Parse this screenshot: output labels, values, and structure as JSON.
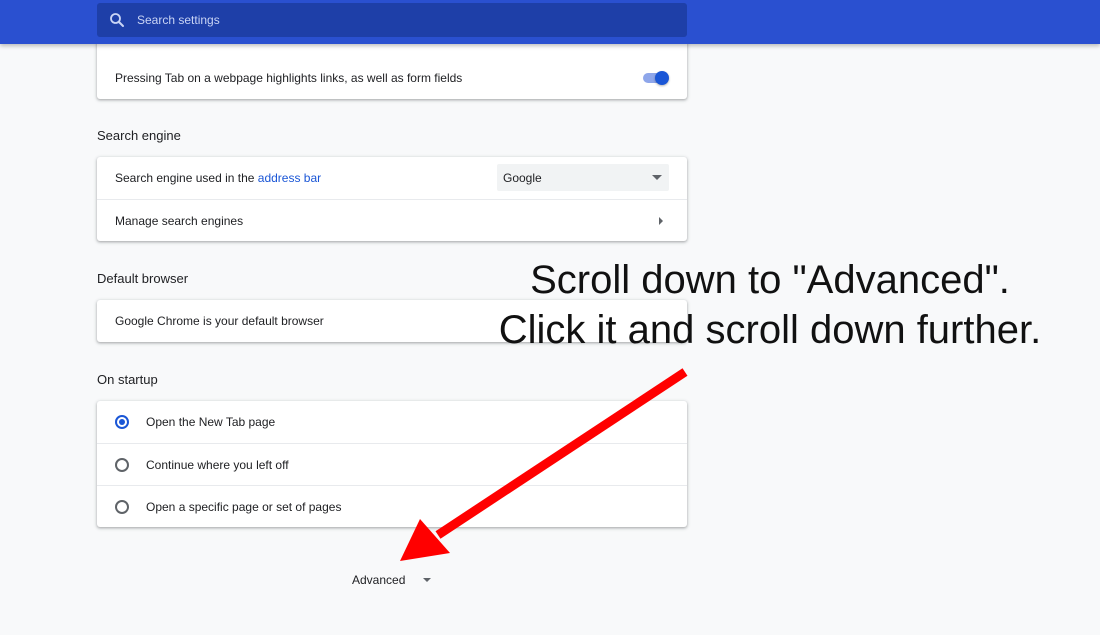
{
  "search": {
    "placeholder": "Search settings"
  },
  "accessibility": {
    "tab_highlight_label": "Pressing Tab on a webpage highlights links, as well as form fields",
    "tab_highlight_enabled": true
  },
  "search_engine": {
    "title": "Search engine",
    "used_in_prefix": "Search engine used in the ",
    "used_in_link": "address bar",
    "selected_engine": "Google",
    "manage_label": "Manage search engines"
  },
  "default_browser": {
    "title": "Default browser",
    "status": "Google Chrome is your default browser"
  },
  "on_startup": {
    "title": "On startup",
    "options": [
      {
        "label": "Open the New Tab page",
        "selected": true
      },
      {
        "label": "Continue where you left off",
        "selected": false
      },
      {
        "label": "Open a specific page or set of pages",
        "selected": false
      }
    ]
  },
  "advanced": {
    "label": "Advanced"
  },
  "annotation": {
    "line1": "Scroll down to \"Advanced\".",
    "line2": "Click it and scroll down further.",
    "arrow_color": "#ff0000"
  },
  "colors": {
    "header": "#2a50d0",
    "accent": "#1a56d6"
  }
}
